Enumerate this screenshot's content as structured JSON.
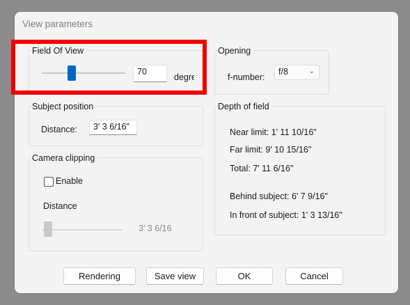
{
  "dialog": {
    "title": "View parameters"
  },
  "field_of_view": {
    "label": "Field Of View",
    "value": "70",
    "unit": "degrees",
    "slider_accent": "#0067c0"
  },
  "opening": {
    "label": "Opening",
    "fnumber_label": "f-number:",
    "fnumber_value": "f/8",
    "chevron_icon": "chevron-down-icon"
  },
  "subject_position": {
    "label": "Subject position",
    "distance_label": "Distance:",
    "distance_value": "3' 3 6/16\""
  },
  "depth_of_field": {
    "label": "Depth of field",
    "near_limit": "Near limit: 1' 11 10/16\"",
    "far_limit": "Far limit: 9' 10 15/16\"",
    "total": "Total: 7' 11 6/16\"",
    "behind_subject": "Behind subject: 6' 7 9/16\"",
    "in_front_of_subject": "In front of subject: 1' 3 13/16\""
  },
  "camera_clipping": {
    "label": "Camera clipping",
    "enable_label": "Enable",
    "enable_checked": false,
    "distance_label": "Distance",
    "distance_value": "3' 3 6/16\""
  },
  "buttons": {
    "rendering": "Rendering",
    "save_view": "Save view",
    "ok": "OK",
    "cancel": "Cancel"
  },
  "colors": {
    "highlight": "#f00000",
    "disabled_thumb": "#c8c8c8"
  }
}
